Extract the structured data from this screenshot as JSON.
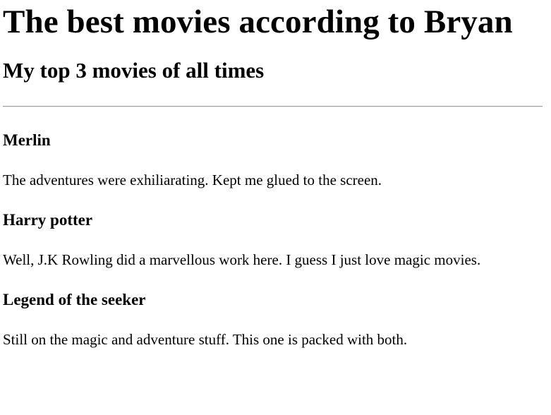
{
  "page": {
    "title": "The best movies according to Bryan",
    "subtitle": "My top 3 movies of all times"
  },
  "movies": [
    {
      "title": "Merlin",
      "description": "The adventures were exhiliarating. Kept me glued to the screen."
    },
    {
      "title": "Harry potter",
      "description": "Well, J.K Rowling did a marvellous work here. I guess I just love magic movies."
    },
    {
      "title": "Legend of the seeker",
      "description": "Still on the magic and adventure stuff. This one is packed with both."
    }
  ]
}
